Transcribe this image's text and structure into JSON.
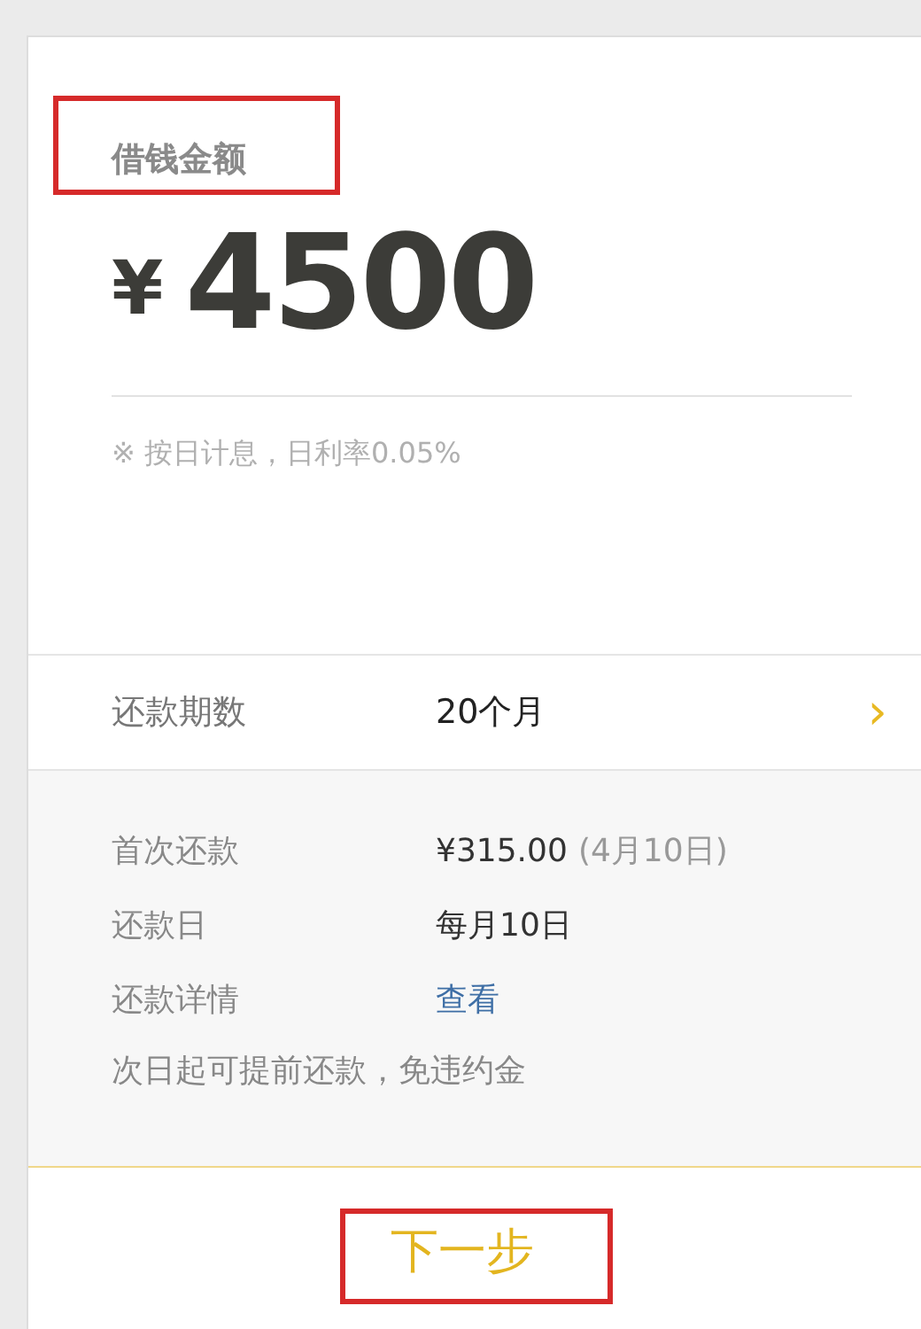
{
  "amount": {
    "label": "借钱金额",
    "label_highlighted": true,
    "currency": "¥",
    "value": "4500",
    "note": "※ 按日计息，日利率0.05%"
  },
  "term": {
    "label": "还款期数",
    "value": "20个月",
    "chevron": "›"
  },
  "details": [
    {
      "kind": "pair",
      "label": "首次还款",
      "value": "¥315.00",
      "extra": "(4月10日)"
    },
    {
      "kind": "pair",
      "label": "还款日",
      "value": "每月10日"
    },
    {
      "kind": "link",
      "label": "还款详情",
      "value": "查看"
    },
    {
      "kind": "note",
      "label": "次日起可提前还款，免违约金"
    }
  ],
  "next_button": {
    "label": "下一步",
    "highlighted": true
  }
}
